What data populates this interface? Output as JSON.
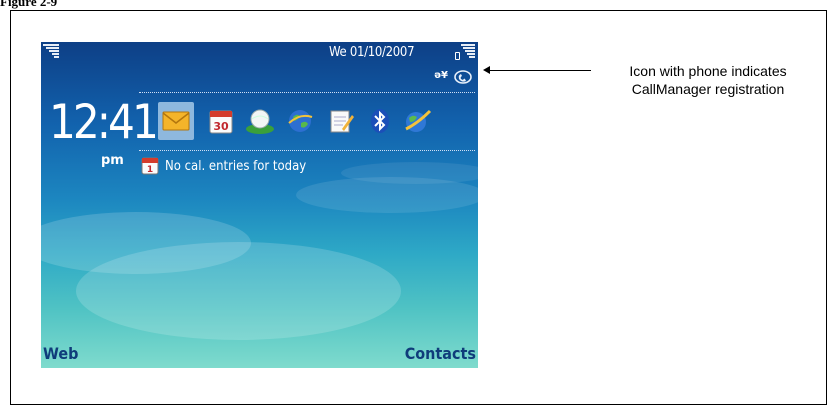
{
  "figure_caption_fragment": "Figure 2-9",
  "phone": {
    "status_bar": {
      "date": "We 01/10/2007",
      "signal_icon": "signal-strength-icon",
      "battery_icon": "battery-level-icon"
    },
    "indicators": {
      "network_mode": "ǝ¥",
      "callmanager_icon": "phone-registration-icon"
    },
    "clock": {
      "time": "12:41",
      "ampm": "pm"
    },
    "toolbar": [
      {
        "icon": "envelope-icon",
        "selected": true
      },
      {
        "icon": "calendar-icon",
        "label": "30"
      },
      {
        "icon": "globe-icon"
      },
      {
        "icon": "world-icon"
      },
      {
        "icon": "notepad-icon"
      },
      {
        "icon": "bluetooth-icon"
      },
      {
        "icon": "web-globe-icon"
      }
    ],
    "calendar_notice": {
      "icon": "calendar-small-icon",
      "icon_label": "1",
      "text": "No cal. entries for today"
    },
    "softkeys": {
      "left": "Web",
      "right": "Contacts"
    }
  },
  "annotation": {
    "line1": "Icon with phone indicates",
    "line2": "CallManager registration"
  }
}
